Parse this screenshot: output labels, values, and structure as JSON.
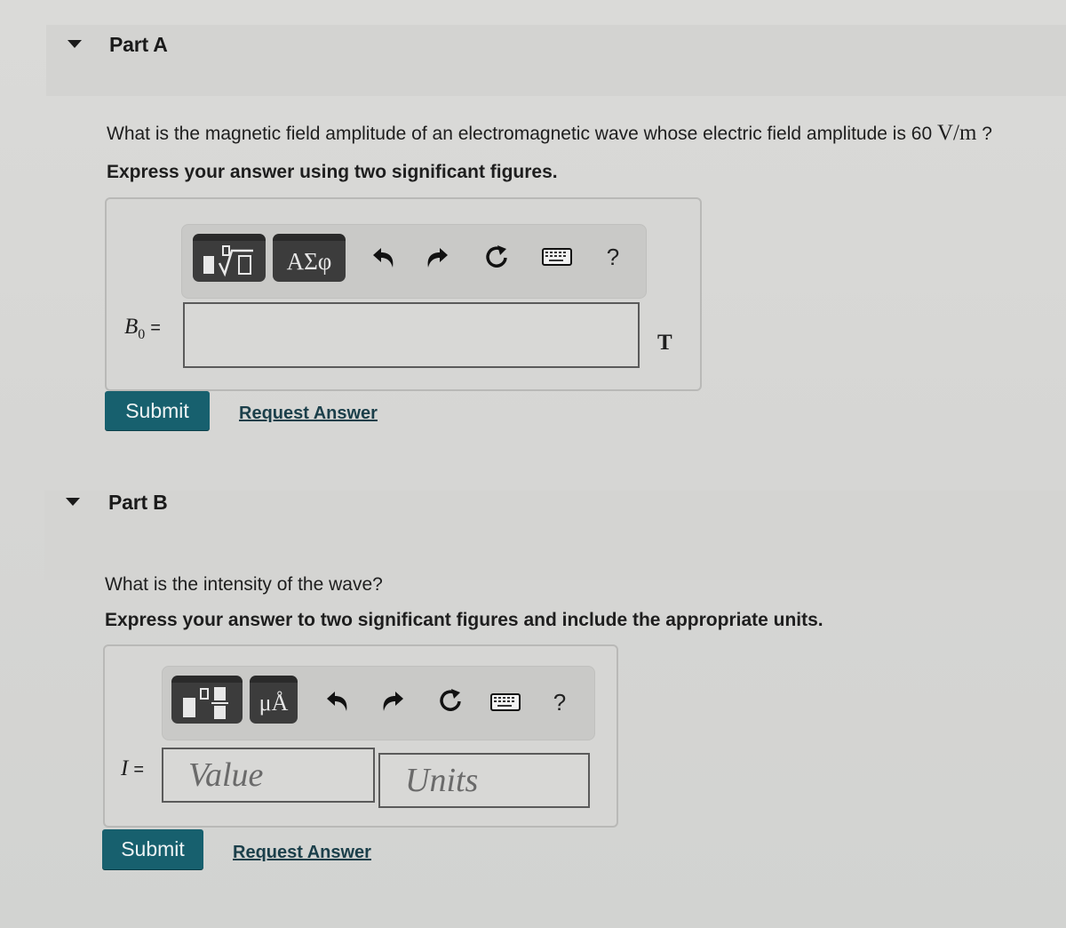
{
  "partA": {
    "title": "Part A",
    "question_prefix": "What is the magnetic field amplitude of an electromagnetic wave whose electric field amplitude is 60 ",
    "question_unit": "V/m",
    "question_suffix": " ?",
    "instruction": "Express your answer using two significant figures.",
    "toolbar": {
      "templates_icon": "templates-sqrt-icon",
      "greek_label": "ΑΣφ",
      "undo_icon": "undo-icon",
      "redo_icon": "redo-icon",
      "reset_icon": "reset-icon",
      "keyboard_icon": "keyboard-icon",
      "help_label": "?"
    },
    "variable": "B",
    "variable_sub": "0",
    "equals": "=",
    "input_value": "",
    "unit": "T",
    "submit_label": "Submit",
    "request_label": "Request Answer"
  },
  "partB": {
    "title": "Part B",
    "question": "What is the intensity of the wave?",
    "instruction": "Express your answer to two significant figures and include the appropriate units.",
    "toolbar": {
      "templates_icon": "templates-fraction-icon",
      "units_label": "μÅ",
      "undo_icon": "undo-icon",
      "redo_icon": "redo-icon",
      "reset_icon": "reset-icon",
      "keyboard_icon": "keyboard-icon",
      "help_label": "?"
    },
    "variable": "I",
    "equals": "=",
    "value_placeholder": "Value",
    "units_placeholder": "Units",
    "submit_label": "Submit",
    "request_label": "Request Answer"
  }
}
